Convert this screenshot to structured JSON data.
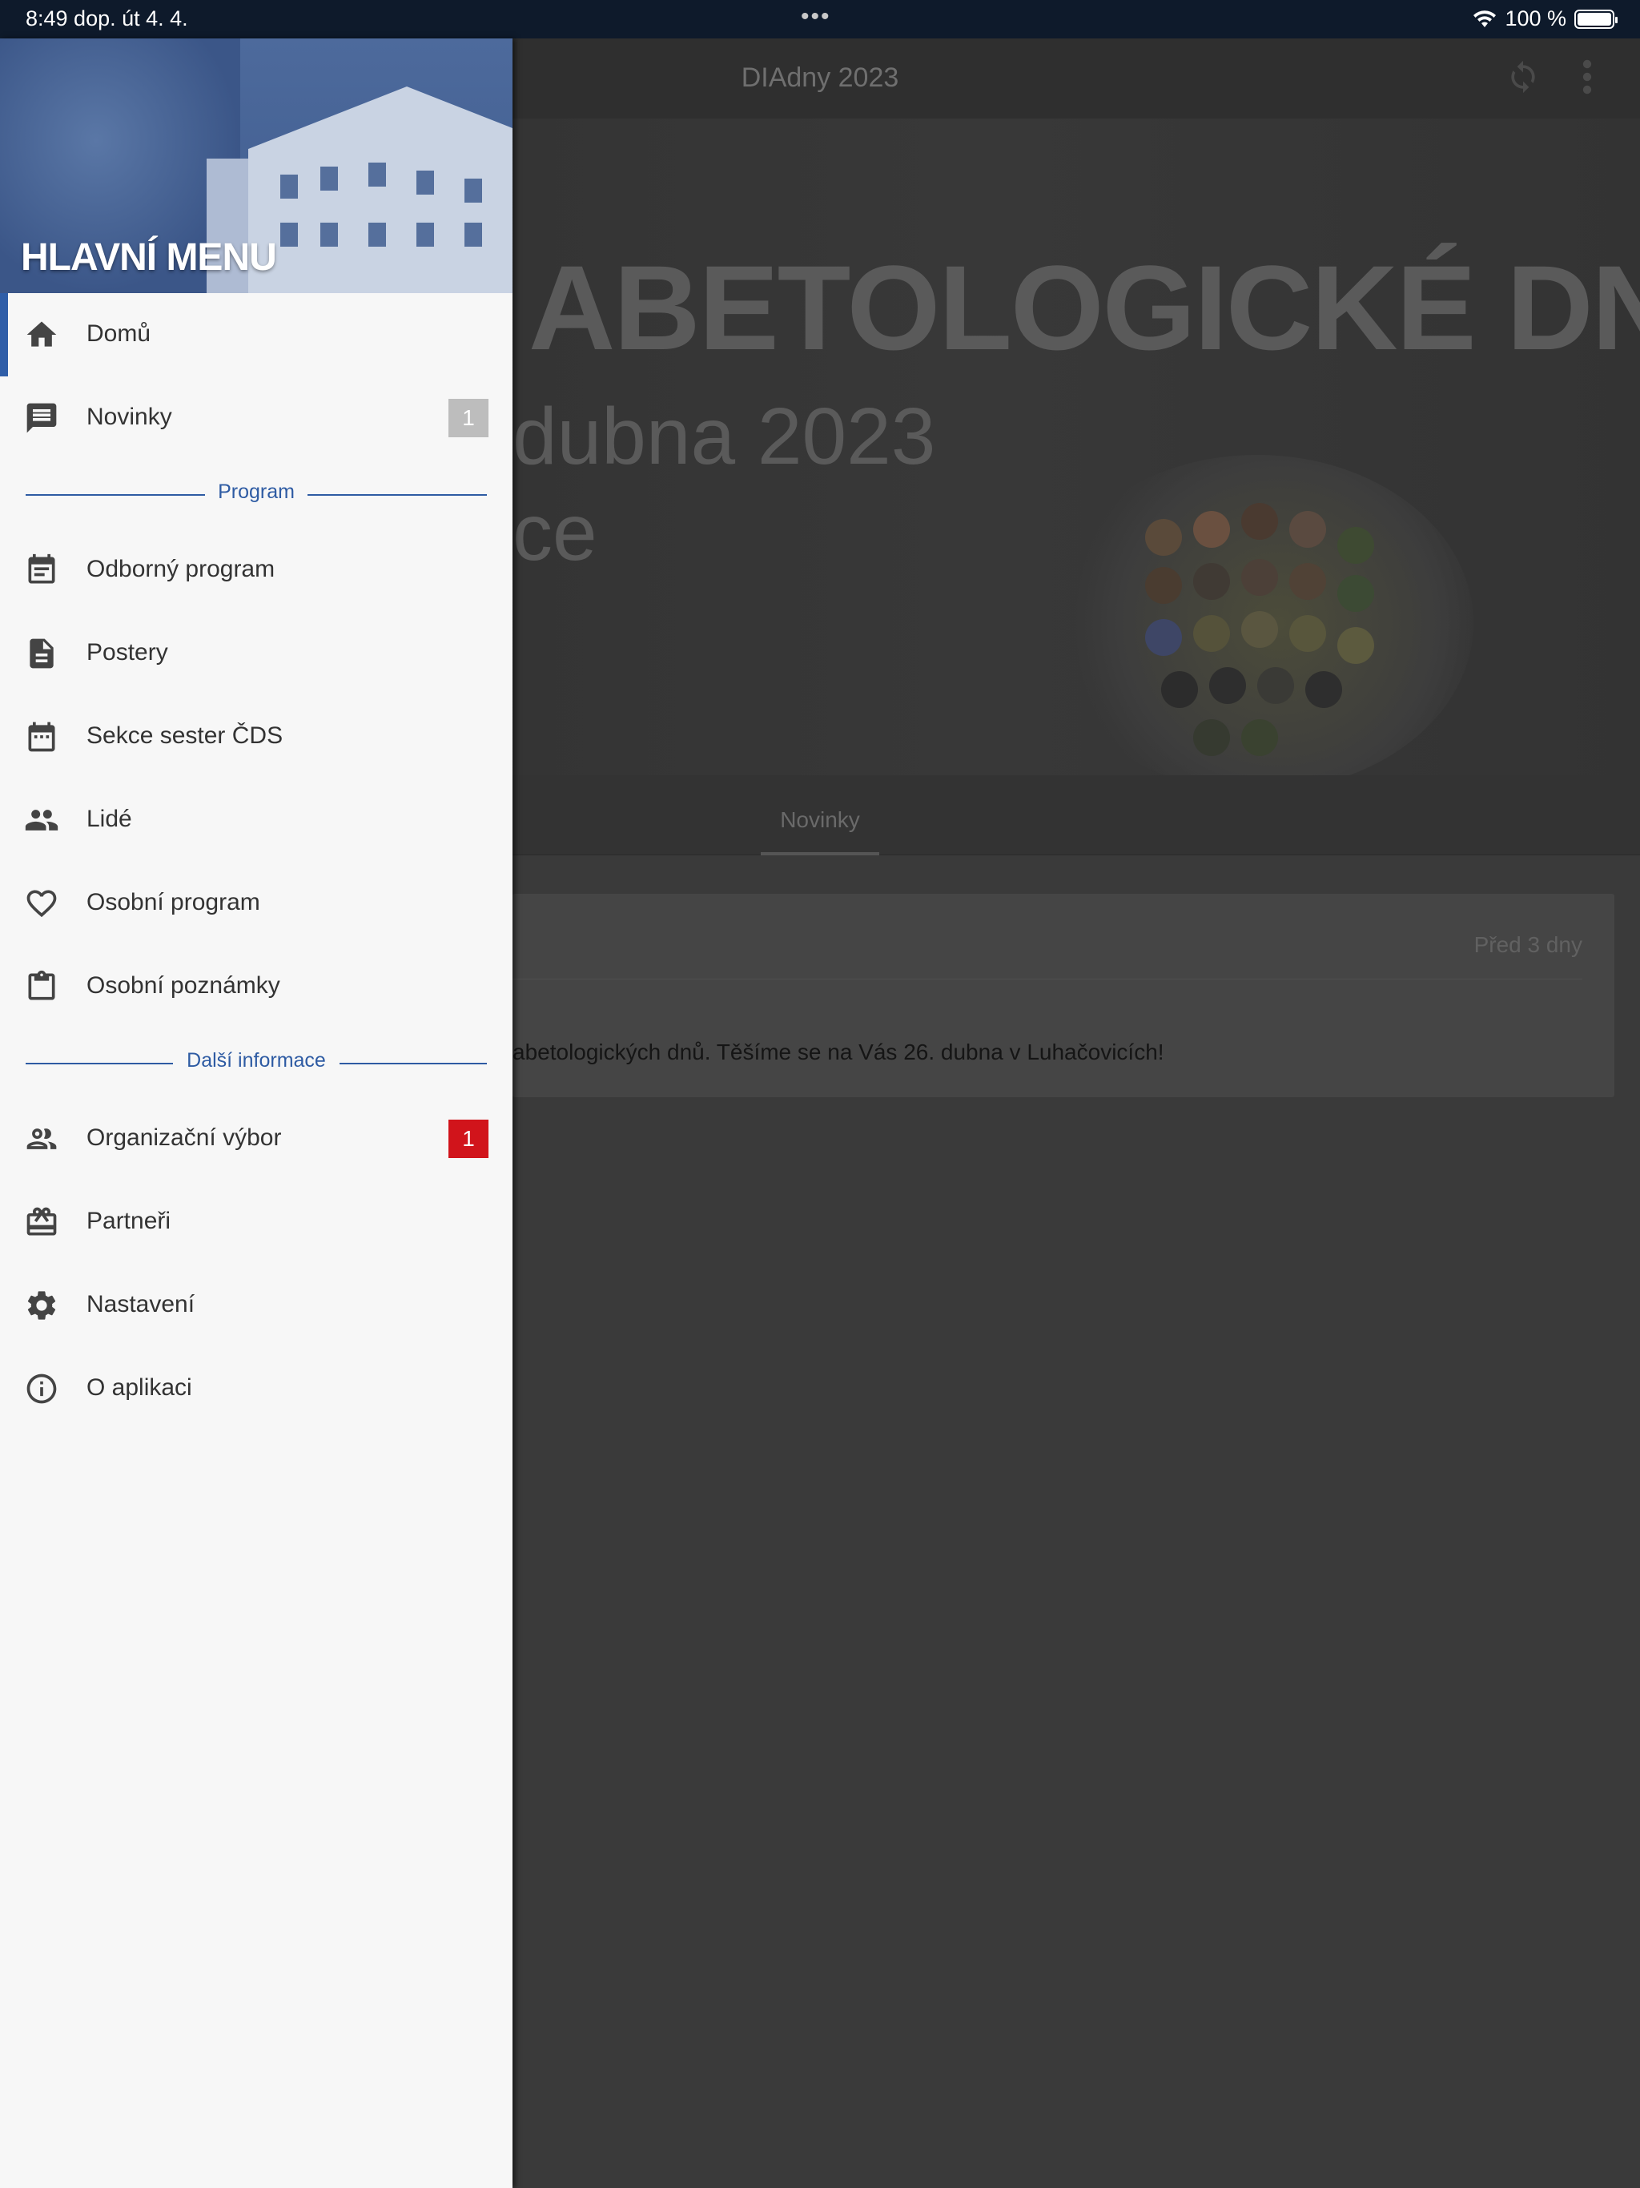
{
  "status_bar": {
    "time": "8:49 dop.   út 4. 4.",
    "battery": "100 %"
  },
  "app": {
    "title": "DIAdny 2023",
    "hero_line1": "ABETOLOGICKÉ DNY",
    "hero_line2": "dubna 2023",
    "hero_line3": "ce",
    "tab": "Novinky",
    "news_date": "Před 3 dny",
    "news_text": "abetologických dnů. Těšíme se na Vás 26. dubna v Luhačovicích!"
  },
  "drawer": {
    "title": "HLAVNÍ MENU",
    "items": [
      {
        "label": "Domů",
        "icon": "home-icon"
      },
      {
        "label": "Novinky",
        "icon": "message-icon",
        "badge": "1"
      },
      {
        "label": "Odborný program",
        "icon": "calendar-text-icon"
      },
      {
        "label": "Postery",
        "icon": "document-icon"
      },
      {
        "label": "Sekce sester ČDS",
        "icon": "calendar-icon"
      },
      {
        "label": "Lidé",
        "icon": "people-icon"
      },
      {
        "label": "Osobní program",
        "icon": "heart-icon"
      },
      {
        "label": "Osobní poznámky",
        "icon": "clipboard-icon"
      },
      {
        "label": "Organizační výbor",
        "icon": "group-outline-icon",
        "badge": "1"
      },
      {
        "label": "Partneři",
        "icon": "gift-card-icon"
      },
      {
        "label": "Nastavení",
        "icon": "gear-icon"
      },
      {
        "label": "O aplikaci",
        "icon": "info-icon"
      }
    ],
    "section_program": "Program",
    "section_more": "Další informace"
  },
  "colors": {
    "accent": "#2f5ea8",
    "badge_red": "#d1141b",
    "badge_grey": "#bdbdbd"
  }
}
